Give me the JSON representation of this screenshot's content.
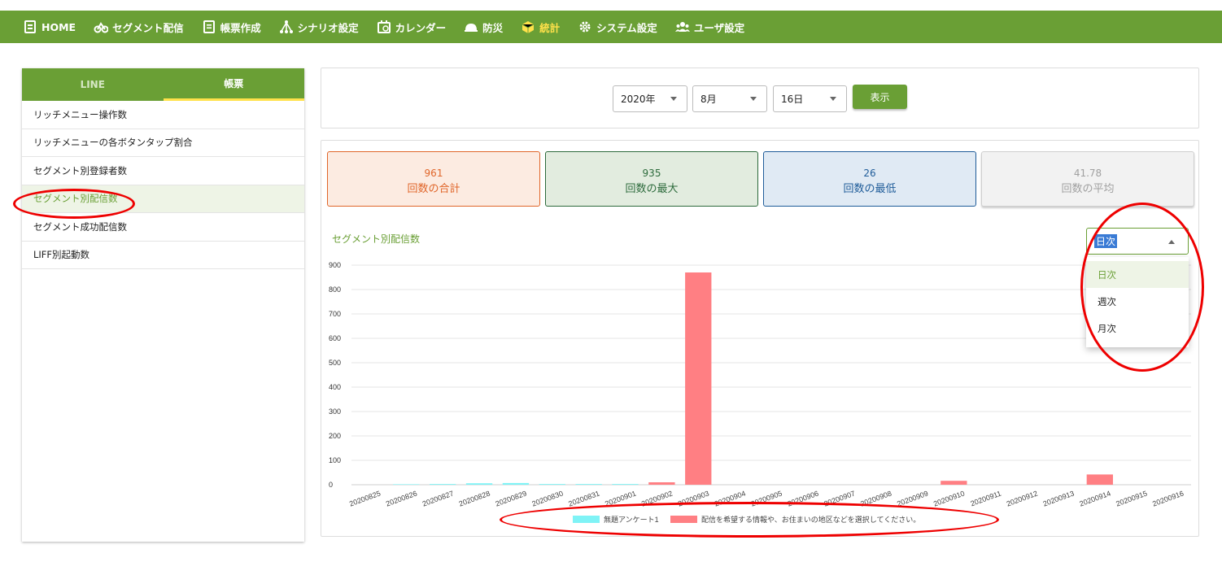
{
  "nav": [
    {
      "label": "HOME",
      "icon": "clipboard-icon"
    },
    {
      "label": "セグメント配信",
      "icon": "bike-icon"
    },
    {
      "label": "帳票作成",
      "icon": "document-icon"
    },
    {
      "label": "シナリオ設定",
      "icon": "tree-icon"
    },
    {
      "label": "カレンダー",
      "icon": "calendar-icon"
    },
    {
      "label": "防災",
      "icon": "helmet-icon"
    },
    {
      "label": "統計",
      "icon": "cube-icon",
      "active": true
    },
    {
      "label": "システム設定",
      "icon": "gear-icon"
    },
    {
      "label": "ユーザ設定",
      "icon": "users-icon"
    }
  ],
  "sidebar": {
    "tabs": [
      "LINE",
      "帳票"
    ],
    "active_tab": "帳票",
    "items": [
      "リッチメニュー操作数",
      "リッチメニューの各ボタンタップ割合",
      "セグメント別登録者数",
      "セグメント別配信数",
      "セグメント成功配信数",
      "LIFF別起動数"
    ],
    "selected": "セグメント別配信数"
  },
  "filters": {
    "year": "2020年",
    "month": "8月",
    "day": "16日",
    "show_label": "表示"
  },
  "stats": [
    {
      "value": "961",
      "label": "回数の合計",
      "color": "#e0662a",
      "bg": "#fcebe1"
    },
    {
      "value": "935",
      "label": "回数の最大",
      "color": "#2d6b3c",
      "bg": "#e2ecdf"
    },
    {
      "value": "26",
      "label": "回数の最低",
      "color": "#1f5c99",
      "bg": "#e0eaf4"
    },
    {
      "value": "41.78",
      "label": "回数の平均",
      "color": "#a0a0a0",
      "bg": "#f2f2f2"
    }
  ],
  "chart_title": "セグメント別配信数",
  "period": {
    "value": "日次",
    "options": [
      "日次",
      "週次",
      "月次"
    ]
  },
  "colors": {
    "accent": "#6a9f35",
    "highlight": "#ffe14a",
    "annotation": "#e00000"
  },
  "chart_data": {
    "type": "bar",
    "categories": [
      "20200825",
      "20200826",
      "20200827",
      "20200828",
      "20200829",
      "20200830",
      "20200831",
      "20200901",
      "20200902",
      "20200903",
      "20200904",
      "20200905",
      "20200906",
      "20200907",
      "20200908",
      "20200909",
      "20200910",
      "20200911",
      "20200912",
      "20200913",
      "20200914",
      "20200915",
      "20200916"
    ],
    "series": [
      {
        "name": "無題アンケート1",
        "color": "#7ff3f6",
        "values": [
          0,
          2,
          3,
          6,
          7,
          3,
          3,
          3,
          0,
          0,
          0,
          0,
          0,
          0,
          0,
          0,
          0,
          0,
          0,
          0,
          0,
          0,
          0
        ]
      },
      {
        "name": "配信を希望する情報や、お住まいの地区などを選択してください。",
        "color": "#ff7f83",
        "values": [
          0,
          0,
          0,
          0,
          0,
          0,
          0,
          0,
          10,
          870,
          0,
          0,
          0,
          0,
          0,
          0,
          16,
          0,
          0,
          0,
          42,
          0,
          0
        ]
      }
    ],
    "yticks": [
      0,
      100,
      200,
      300,
      400,
      500,
      600,
      700,
      800,
      900
    ],
    "ylim": [
      0,
      900
    ],
    "grid": true,
    "legend": "bottom"
  }
}
